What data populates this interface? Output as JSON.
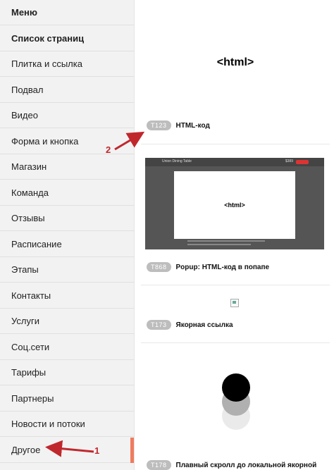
{
  "sidebar": {
    "items": [
      {
        "label": "Меню",
        "bold": true
      },
      {
        "label": "Список страниц",
        "bold": true
      },
      {
        "label": "Плитка и ссылка"
      },
      {
        "label": "Подвал"
      },
      {
        "label": "Видео"
      },
      {
        "label": "Форма и кнопка"
      },
      {
        "label": "Магазин"
      },
      {
        "label": "Команда"
      },
      {
        "label": "Отзывы"
      },
      {
        "label": "Расписание"
      },
      {
        "label": "Этапы"
      },
      {
        "label": "Контакты"
      },
      {
        "label": "Услуги"
      },
      {
        "label": "Соц.сети"
      },
      {
        "label": "Тарифы"
      },
      {
        "label": "Партнеры"
      },
      {
        "label": "Новости и потоки"
      },
      {
        "label": "Другое",
        "active": true
      }
    ]
  },
  "content": {
    "html_block_title": "<html>",
    "blocks": [
      {
        "code": "T123",
        "label": "HTML-код"
      },
      {
        "code": "T868",
        "label": "Popup: HTML-код в попапе"
      },
      {
        "code": "T173",
        "label": "Якорная ссылка"
      },
      {
        "code": "T178",
        "label": "Плавный скролл до локальной якорной"
      }
    ],
    "popup_preview": {
      "window_title": "Union Dining Table",
      "price": "$389",
      "inner_text": "<html>"
    }
  },
  "annotations": {
    "marker_1": "1",
    "marker_2": "2",
    "color": "#c0272d"
  },
  "colors": {
    "sidebar_bg": "#f2f2f2",
    "active_accent": "#f07b5f",
    "badge_bg": "#bdbdbd"
  }
}
